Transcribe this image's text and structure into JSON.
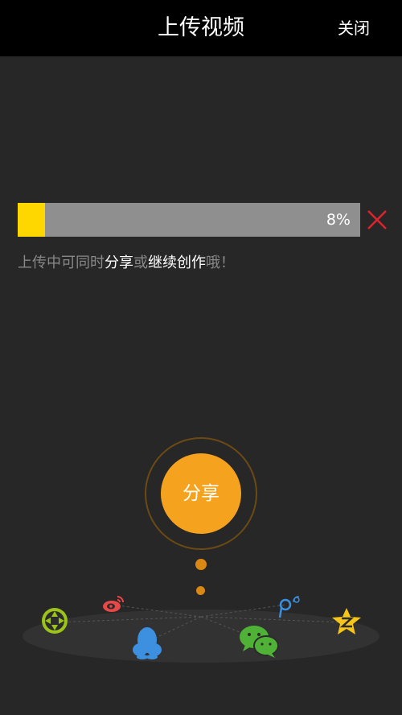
{
  "header": {
    "title": "上传视频",
    "close_label": "关闭"
  },
  "upload": {
    "progress_percent": 8,
    "progress_label": "8%",
    "hint_parts": [
      "上传中可同时",
      "分享",
      "或",
      "继续创作",
      "哦！"
    ]
  },
  "share": {
    "button_label": "分享",
    "platforms": [
      "camera-aperture-icon",
      "weibo-icon",
      "qq-icon",
      "wechat-icon",
      "tencent-weibo-icon",
      "qzone-icon"
    ]
  },
  "colors": {
    "accent": "#f5a31e",
    "progress_fill": "#ffd700",
    "cancel": "#e0232e",
    "header_bg": "#000000",
    "page_bg": "#272727"
  }
}
